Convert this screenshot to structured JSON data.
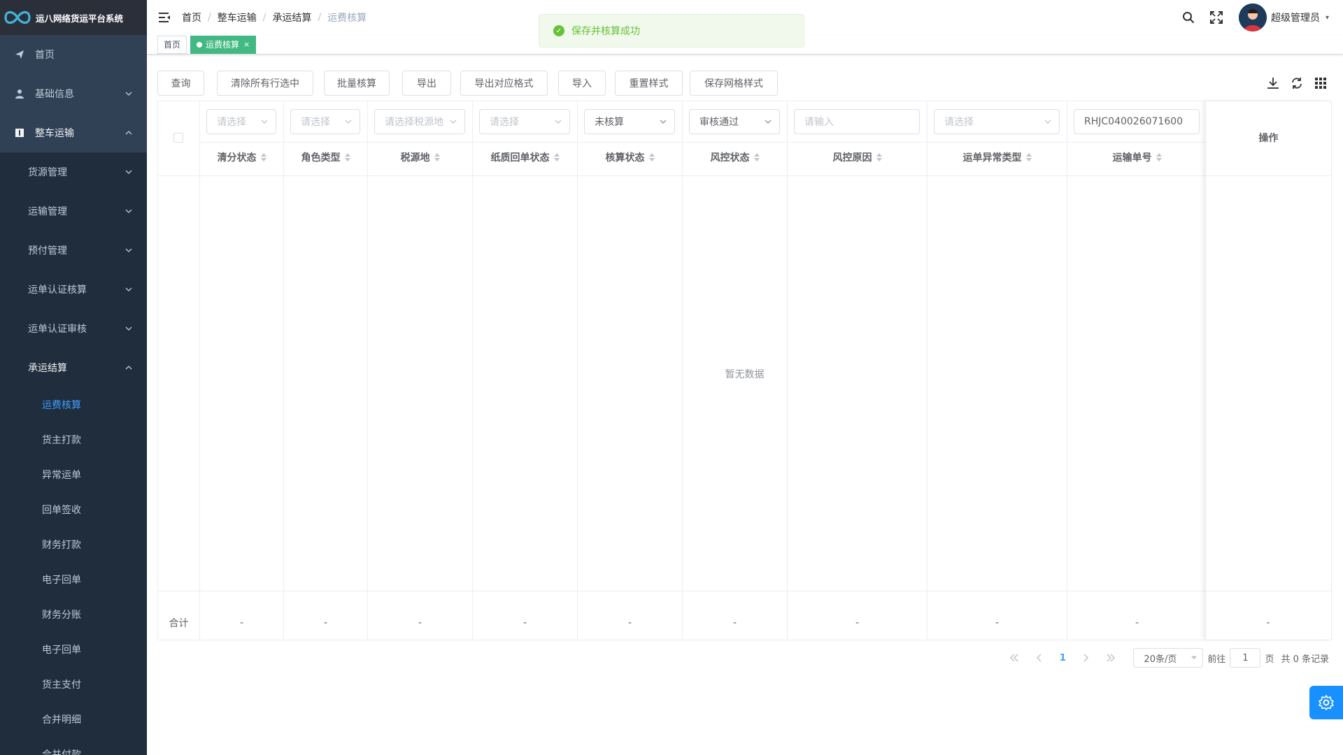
{
  "app": {
    "title": "运八网络货运平台系统"
  },
  "sidebar": {
    "items": [
      {
        "label": "首页",
        "icon": "send-icon"
      },
      {
        "label": "基础信息",
        "icon": "user-icon"
      },
      {
        "label": "整车运输",
        "icon": "info-icon"
      }
    ],
    "sub_items": [
      {
        "label": "货源管理"
      },
      {
        "label": "运输管理"
      },
      {
        "label": "预付管理"
      },
      {
        "label": "运单认证核算"
      },
      {
        "label": "运单认证审核"
      },
      {
        "label": "承运结算"
      }
    ],
    "leaves": [
      {
        "label": "运费核算"
      },
      {
        "label": "货主打款"
      },
      {
        "label": "异常运单"
      },
      {
        "label": "回单签收"
      },
      {
        "label": "财务打款"
      },
      {
        "label": "电子回单"
      },
      {
        "label": "财务分账"
      },
      {
        "label": "电子回单"
      },
      {
        "label": "货主支付"
      },
      {
        "label": "合并明细"
      },
      {
        "label": "合并付款"
      }
    ]
  },
  "breadcrumb": [
    "首页",
    "整车运输",
    "承运结算",
    "运费核算"
  ],
  "breadcrumb_sep": "/",
  "user": {
    "name": "超级管理员",
    "caret": "▾"
  },
  "tags": [
    {
      "label": "首页"
    },
    {
      "label": "运费核算",
      "close": "×"
    }
  ],
  "toast": {
    "text": "保存并核算成功",
    "check": "✓"
  },
  "toolbar": {
    "buttons": [
      "查询",
      "清除所有行选中",
      "批量核算",
      "导出",
      "导出对应格式",
      "导入",
      "重置样式",
      "保存网格样式"
    ]
  },
  "table": {
    "filters": [
      {
        "text": "请选择",
        "filled": false,
        "select": true
      },
      {
        "text": "请选择",
        "filled": false,
        "select": true
      },
      {
        "text": "请选择税源地",
        "filled": false,
        "select": true
      },
      {
        "text": "请选择",
        "filled": false,
        "select": true
      },
      {
        "text": "未核算",
        "filled": true,
        "select": true
      },
      {
        "text": "审核通过",
        "filled": true,
        "select": true
      },
      {
        "text": "请输入",
        "filled": false,
        "select": false
      },
      {
        "text": "请选择",
        "filled": false,
        "select": true
      },
      {
        "text": "RHJC040026071600",
        "filled": true,
        "select": false
      }
    ],
    "headers": [
      "清分状态",
      "角色类型",
      "税源地",
      "纸质回单状态",
      "核算状态",
      "风控状态",
      "风控原因",
      "运单异常类型",
      "运输单号"
    ],
    "op_header": "操作",
    "empty_text": "暂无数据",
    "summary_label": "合计",
    "summary_values": [
      "-",
      "-",
      "-",
      "-",
      "-",
      "-",
      "-",
      "-",
      "-",
      "-"
    ]
  },
  "pagination": {
    "current_page": "1",
    "page_size": "20条/页",
    "goto_label": "前往",
    "goto_value": "1",
    "page_unit": "页",
    "total": "共 0 条记录"
  },
  "colors": {
    "sidebar_bg": "#304156",
    "logo_bg": "#2b2f3a",
    "active_tag": "#42b983",
    "accent": "#409eff",
    "success": "#67c23a"
  }
}
